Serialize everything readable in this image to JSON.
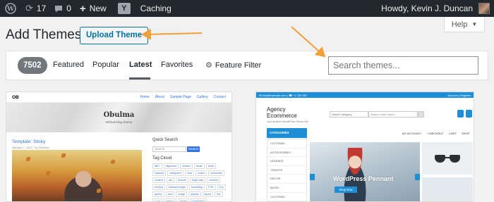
{
  "admin_bar": {
    "updates_count": "17",
    "comments_count": "0",
    "new_label": "New",
    "yoast_letter": "Y",
    "caching_label": "Caching",
    "greeting": "Howdy, Kevin J. Duncan"
  },
  "header": {
    "title": "Add Themes",
    "upload_button": "Upload Theme",
    "help_button": "Help"
  },
  "filter": {
    "theme_count": "7502",
    "tabs": [
      "Featured",
      "Popular",
      "Latest",
      "Favorites"
    ],
    "active_tab": "Latest",
    "feature_filter": "Feature Filter",
    "search_placeholder": "Search themes..."
  },
  "annotation_color": "#f0a03a",
  "themes": [
    {
      "nav_brand": "OB",
      "nav_links": [
        "Home",
        "About",
        "Sample Page",
        "Gallery",
        "Contact"
      ],
      "hero_title": "Obulma",
      "hero_subtitle": "Default blog theme",
      "post_title": "Template: Sticky",
      "post_meta": "January 7, 2012 · by Obulmer",
      "sidebar_search_title": "Quick Search",
      "sidebar_search_placeholder": "Search",
      "sidebar_search_button": "Search",
      "tag_cloud_title": "Tag Cloud",
      "tags": [
        "8BIT",
        "alignment",
        "Articles",
        "aside",
        "audio",
        "captions",
        "categories",
        "chat",
        "Codex",
        "comments",
        "content",
        "css",
        "dowork",
        "edge case",
        "embeds",
        "excerpt",
        "featured image",
        "formatting",
        "FTW",
        "Fun",
        "gallery",
        "html",
        "image",
        "jetpack",
        "layout",
        "link",
        "Love",
        "markup",
        "media",
        "Mothership"
      ]
    },
    {
      "topbar_left": "✉ info@example.com  |  ☎ +1 234 567",
      "topbar_right": "Account  |  Register",
      "title_line1": "Agency",
      "title_line2": "Ecommerce",
      "tagline": "Just another WordPress Demo site",
      "category_select": "Select Category",
      "search_placeholder": "Search entire store...",
      "category_button": "CATEGORIES",
      "nav_links": [
        "MY ACCOUNT",
        "CHECKOUT",
        "CART",
        "SHOP"
      ],
      "categories": [
        "CLOTHING",
        "ACCESSORIES",
        "HOODIES",
        "TSHIRTS",
        "DECOR",
        "MUSIC",
        "CLOTHING"
      ],
      "slider_title": "WordPress Pennant",
      "slider_button": "Shop Now"
    }
  ]
}
